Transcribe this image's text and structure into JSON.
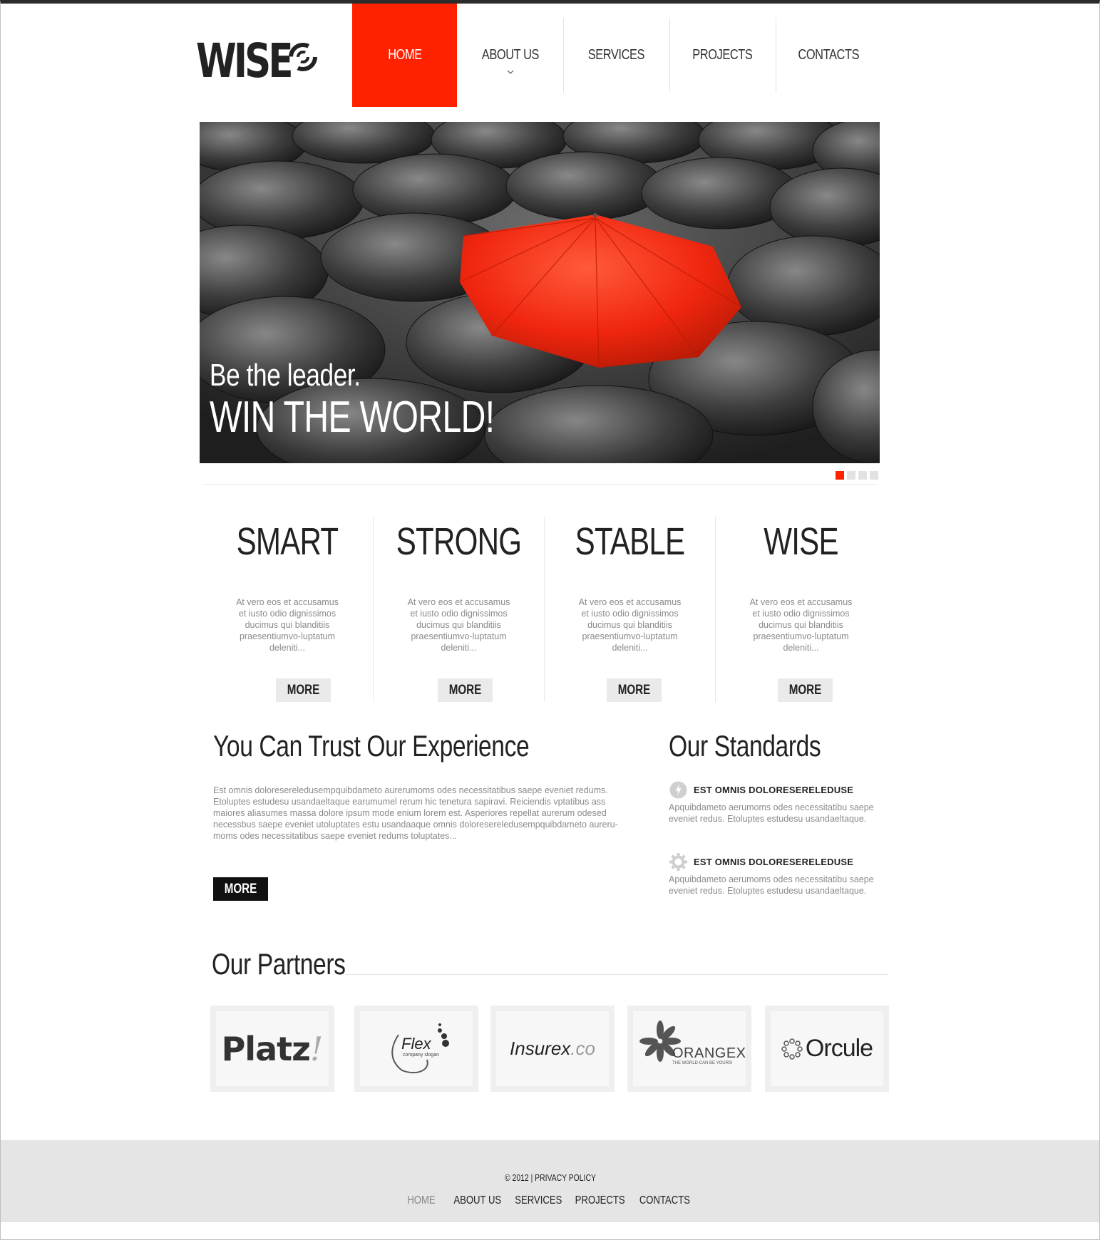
{
  "brand": {
    "name": "WISE",
    "accent": "#ff2200"
  },
  "nav": [
    {
      "label": "HOME",
      "active": true
    },
    {
      "label": "ABOUT US",
      "has_dropdown": true
    },
    {
      "label": "SERVICES"
    },
    {
      "label": "PROJECTS"
    },
    {
      "label": "CONTACTS"
    }
  ],
  "slider": {
    "line1": "Be the leader.",
    "line2": "WIN THE WORLD!",
    "slide_count": 4,
    "current_slide": 1
  },
  "features": [
    {
      "title": "SMART",
      "text": "At vero eos et accusamus et iusto odio dignissimos ducimus qui blanditiis praesentiumvo-luptatum deleniti...",
      "button": "MORE"
    },
    {
      "title": "STRONG",
      "text": "At vero eos et accusamus et iusto odio dignissimos ducimus qui blanditiis praesentiumvo-luptatum deleniti...",
      "button": "MORE"
    },
    {
      "title": "STABLE",
      "text": "At vero eos et accusamus et iusto odio dignissimos ducimus qui blanditiis praesentiumvo-luptatum deleniti...",
      "button": "MORE"
    },
    {
      "title": "WISE",
      "text": "At vero eos et accusamus et iusto odio dignissimos ducimus qui blanditiis praesentiumvo-luptatum deleniti...",
      "button": "MORE"
    }
  ],
  "trust": {
    "title": "You Can Trust Our Experience",
    "text": "Est omnis doloresereledusempquibdameto aurerumoms odes necessitatibus saepe eveniet redums. Etoluptes estudesu usandaeltaque earumumel rerum hic tenetura sapiravi. Reiciendis vptatibus ass maiores aliasumes massa dolore ipsum mode enium lorem est. Asperiores repellat aurerum odesed necessbus saepe eveniet utoluptates estu usandaaque omnis doloresereledusempquibdameto aureru-moms odes necessitatibus saepe eveniet redums toluptates...",
    "button": "MORE"
  },
  "standards": {
    "title": "Our Standards",
    "items": [
      {
        "icon": "lightning-icon",
        "heading": "EST OMNIS DOLORESERELEDUSE",
        "text": "Apquibdameto aerumoms odes necessitatibu saepe eveniet redus. Etoluptes estudesu usandaeltaque."
      },
      {
        "icon": "gear-icon",
        "heading": "EST OMNIS DOLORESERELEDUSE",
        "text": "Apquibdameto aerumoms odes necessitatibu saepe eveniet redus. Etoluptes estudesu usandaeltaque."
      }
    ]
  },
  "partners": {
    "title": "Our Partners",
    "logos": [
      {
        "name": "Platz",
        "mark": "!"
      },
      {
        "name": "Flex",
        "tagline": "company slogan"
      },
      {
        "name": "Insurex",
        "suffix": ".co"
      },
      {
        "name": "ORANGEX",
        "tagline": "THE WORLD CAN BE YOURS!"
      },
      {
        "name": "Orcule"
      }
    ]
  },
  "footer": {
    "copyright": "© 2012 | PRIVACY POLICY",
    "nav": [
      "HOME",
      "ABOUT US",
      "SERVICES",
      "PROJECTS",
      "CONTACTS"
    ]
  }
}
